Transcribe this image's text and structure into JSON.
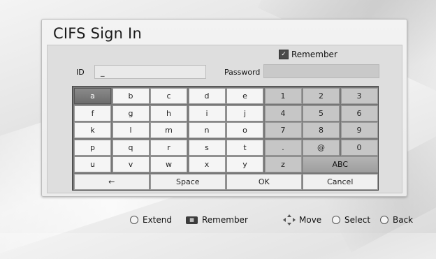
{
  "dialog": {
    "title": "CIFS Sign In",
    "remember_label": "Remember",
    "remember_checked": true,
    "id_label": "ID",
    "id_value": "_",
    "password_label": "Password",
    "password_value": ""
  },
  "keyboard": {
    "rows": [
      [
        "a",
        "b",
        "c",
        "d",
        "e",
        "1",
        "2",
        "3"
      ],
      [
        "f",
        "g",
        "h",
        "i",
        "j",
        "4",
        "5",
        "6"
      ],
      [
        "k",
        "l",
        "m",
        "n",
        "o",
        "7",
        "8",
        "9"
      ],
      [
        "p",
        "q",
        "r",
        "s",
        "t",
        ".",
        "@",
        "0"
      ],
      [
        "u",
        "v",
        "w",
        "x",
        "y",
        "z"
      ]
    ],
    "abc_label": "ABC",
    "bottom": [
      "←",
      "Space",
      "OK",
      "Cancel"
    ],
    "selected_key": "a"
  },
  "legend": {
    "extend": "Extend",
    "remember": "Remember",
    "move": "Move",
    "select": "Select",
    "back": "Back"
  }
}
